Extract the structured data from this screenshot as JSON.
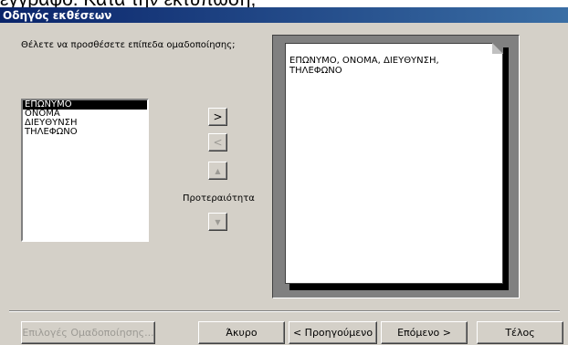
{
  "background_text": "έγγραφο. Κατά την εκτύπωση,",
  "window": {
    "title": "Οδηγός εκθέσεων"
  },
  "prompt": "Θέλετε να προσθέσετε επίπεδα ομαδοποίησης;",
  "fields": [
    "ΕΠΩΝΥΜΟ",
    "ΟΝΟΜΑ",
    "ΔΙΕΥΘΥΝΣΗ",
    "ΤΗΛΕΦΩΝΟ"
  ],
  "selected_field": "ΕΠΩΝΥΜΟ",
  "buttons": {
    "add": ">",
    "remove": "<",
    "priority_up": "▲",
    "priority_down": "▼",
    "priority_label": "Προτεραιότητα"
  },
  "preview": {
    "text": "ΕΠΩΝΥΜΟ, ΟΝΟΜΑ, ΔΙΕΥΘΥΝΣΗ, ΤΗΛΕΦΩΝΟ"
  },
  "footer": {
    "grouping_options": "Επιλογές Ομαδοποίησης...",
    "cancel": "Άκυρο",
    "back": "< Προηγούμενο",
    "next": "Επόμενο >",
    "finish": "Τέλος"
  },
  "colors": {
    "titlebar_start": "#0a246a",
    "titlebar_end": "#3a6ea5",
    "face": "#d4d0c8"
  }
}
